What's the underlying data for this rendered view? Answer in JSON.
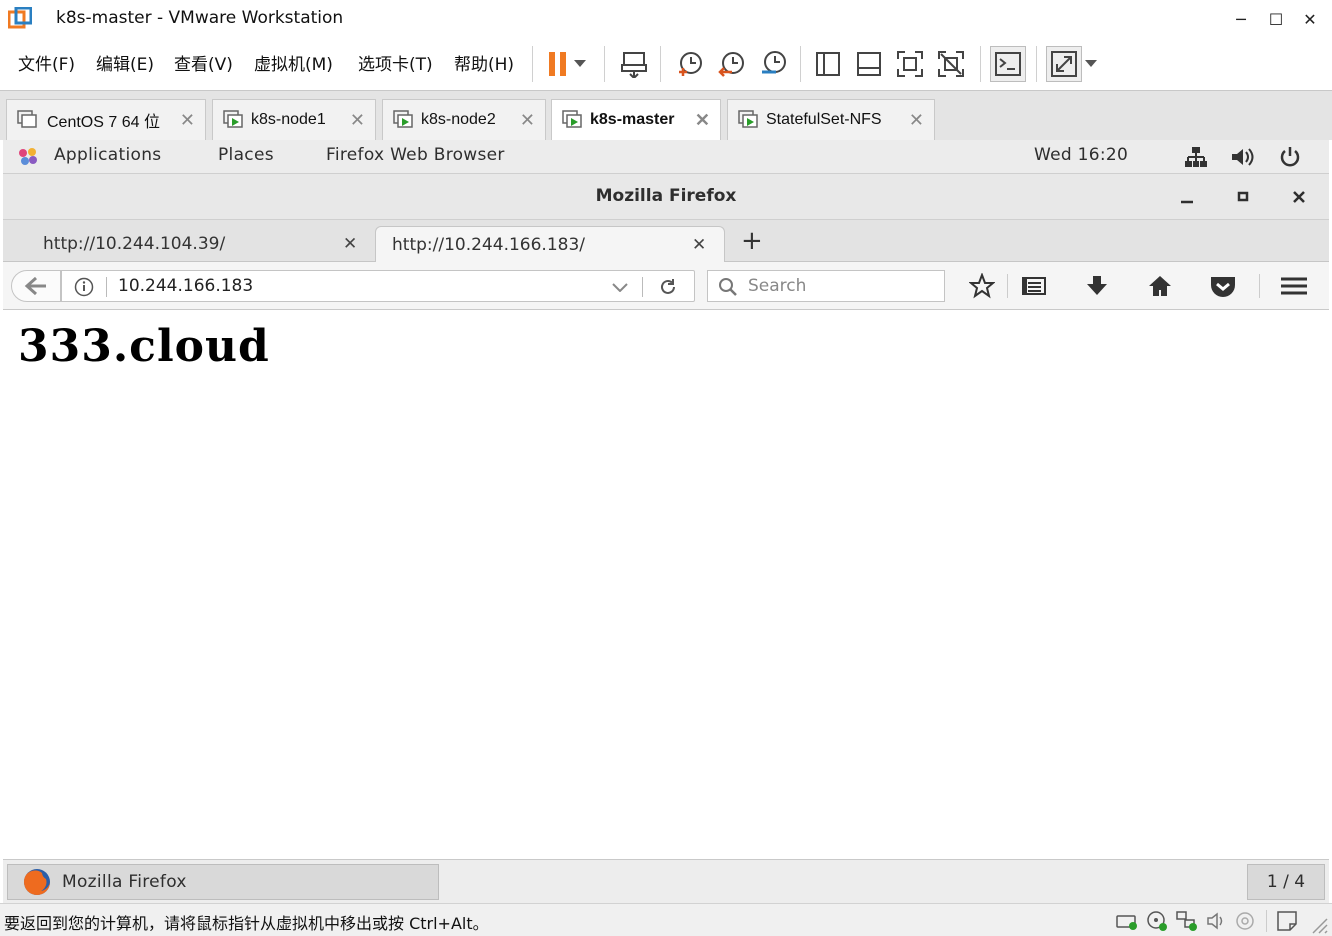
{
  "vmware": {
    "title": "k8s-master - VMware Workstation",
    "window_controls": {
      "minimize": "─",
      "maximize": "☐",
      "close": "✕"
    },
    "menu": [
      "文件(F)",
      "编辑(E)",
      "查看(V)",
      "虚拟机(M)",
      "选项卡(T)",
      "帮助(H)"
    ],
    "tabs": [
      {
        "label": "CentOS 7 64 位",
        "active": false
      },
      {
        "label": "k8s-node1",
        "active": false
      },
      {
        "label": "k8s-node2",
        "active": false
      },
      {
        "label": "k8s-master",
        "active": true
      },
      {
        "label": "StatefulSet-NFS",
        "active": false
      }
    ],
    "status_text": "要返回到您的计算机，请将鼠标指针从虚拟机中移出或按 Ctrl+Alt。",
    "accent_color": "#f07a22"
  },
  "gnome": {
    "applications": "Applications",
    "places": "Places",
    "active_app": "Firefox Web Browser",
    "clock": "Wed 16:20",
    "taskbar_item": "Mozilla Firefox",
    "workspace": "1 / 4"
  },
  "firefox": {
    "window_title": "Mozilla Firefox",
    "tabs": [
      {
        "title": "http://10.244.104.39/",
        "active": false
      },
      {
        "title": "http://10.244.166.183/",
        "active": true
      }
    ],
    "new_tab": "+",
    "url": "10.244.166.183",
    "search_placeholder": "Search",
    "page_heading": "333.cloud"
  }
}
